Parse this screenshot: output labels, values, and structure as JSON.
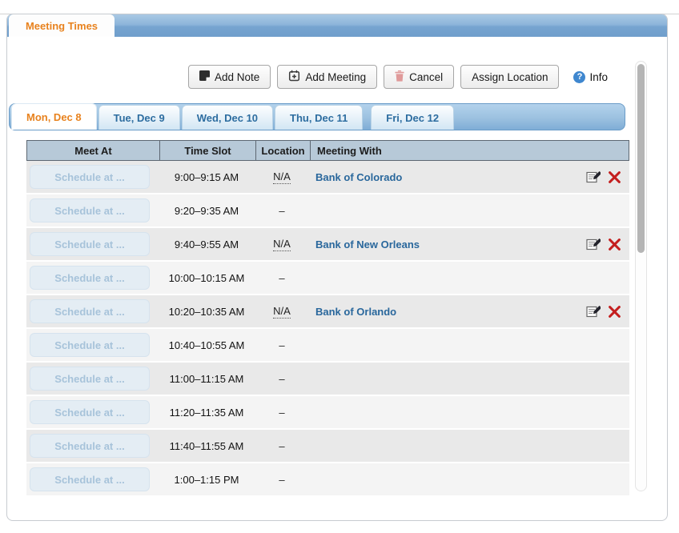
{
  "page": {
    "tab_label": "Meeting Times"
  },
  "toolbar": {
    "add_note": "Add Note",
    "add_meeting": "Add Meeting",
    "cancel": "Cancel",
    "assign_location": "Assign Location",
    "info": "Info"
  },
  "day_tabs": {
    "tabs": [
      {
        "label": "Mon, Dec 8",
        "active": true
      },
      {
        "label": "Tue, Dec 9",
        "active": false
      },
      {
        "label": "Wed, Dec 10",
        "active": false
      },
      {
        "label": "Thu, Dec 11",
        "active": false
      },
      {
        "label": "Fri, Dec 12",
        "active": false
      }
    ]
  },
  "schedule": {
    "columns": {
      "meet_at": "Meet At",
      "time_slot": "Time Slot",
      "location": "Location",
      "meeting_with": "Meeting With"
    },
    "schedule_button_label": "Schedule at ...",
    "rows": [
      {
        "time": "9:00–9:15 AM",
        "location": "N/A",
        "meeting_with": "Bank of Colorado",
        "has_meeting": true
      },
      {
        "time": "9:20–9:35 AM",
        "location": "–",
        "meeting_with": "",
        "has_meeting": false
      },
      {
        "time": "9:40–9:55 AM",
        "location": "N/A",
        "meeting_with": "Bank of New Orleans",
        "has_meeting": true
      },
      {
        "time": "10:00–10:15 AM",
        "location": "–",
        "meeting_with": "",
        "has_meeting": false
      },
      {
        "time": "10:20–10:35 AM",
        "location": "N/A",
        "meeting_with": "Bank of Orlando",
        "has_meeting": true
      },
      {
        "time": "10:40–10:55 AM",
        "location": "–",
        "meeting_with": "",
        "has_meeting": false
      },
      {
        "time": "11:00–11:15 AM",
        "location": "–",
        "meeting_with": "",
        "has_meeting": false
      },
      {
        "time": "11:20–11:35 AM",
        "location": "–",
        "meeting_with": "",
        "has_meeting": false
      },
      {
        "time": "11:40–11:55 AM",
        "location": "–",
        "meeting_with": "",
        "has_meeting": false
      },
      {
        "time": "1:00–1:15 PM",
        "location": "–",
        "meeting_with": "",
        "has_meeting": false
      }
    ]
  },
  "icons": {
    "note": "note-icon",
    "calendar_plus": "calendar-plus-icon",
    "trash": "trash-icon",
    "help": "help-icon",
    "edit_note": "edit-note-icon",
    "delete_x": "delete-x-icon"
  },
  "colors": {
    "accent_orange": "#e8821e",
    "link_blue": "#29679c",
    "tab_bar_blue": "#7fadd6",
    "header_blue_gray": "#b7c9d8",
    "delete_red": "#c41e1e",
    "info_blue": "#3f87cf"
  }
}
